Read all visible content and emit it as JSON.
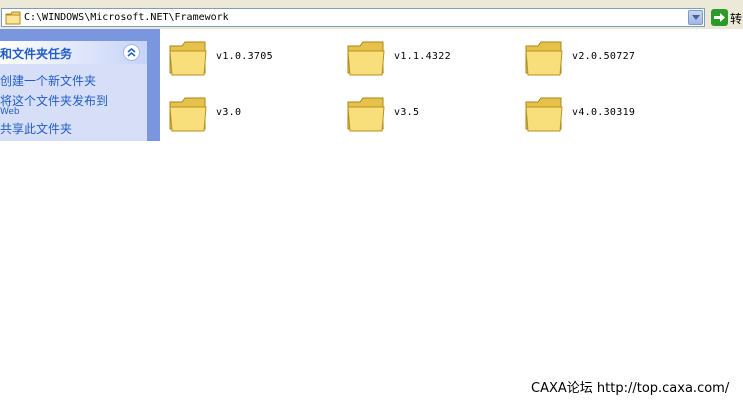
{
  "address_bar": {
    "path": "C:\\WINDOWS\\Microsoft.NET\\Framework",
    "go_label": "转"
  },
  "task_pane": {
    "title": "和文件夹任务",
    "links": [
      "创建一个新文件夹",
      "将这个文件夹发布到",
      "共享此文件夹"
    ],
    "link_subtext": "Web"
  },
  "folders": [
    {
      "name": "v1.0.3705"
    },
    {
      "name": "v1.1.4322"
    },
    {
      "name": "v2.0.50727"
    },
    {
      "name": "v3.0"
    },
    {
      "name": "v3.5"
    },
    {
      "name": "v4.0.30319"
    }
  ],
  "watermark": "CAXA论坛 http://top.caxa.com/",
  "colors": {
    "task_link": "#215dc6",
    "task_pane_bg": "#7a96df",
    "folder_yellow": "#f5d96b"
  }
}
